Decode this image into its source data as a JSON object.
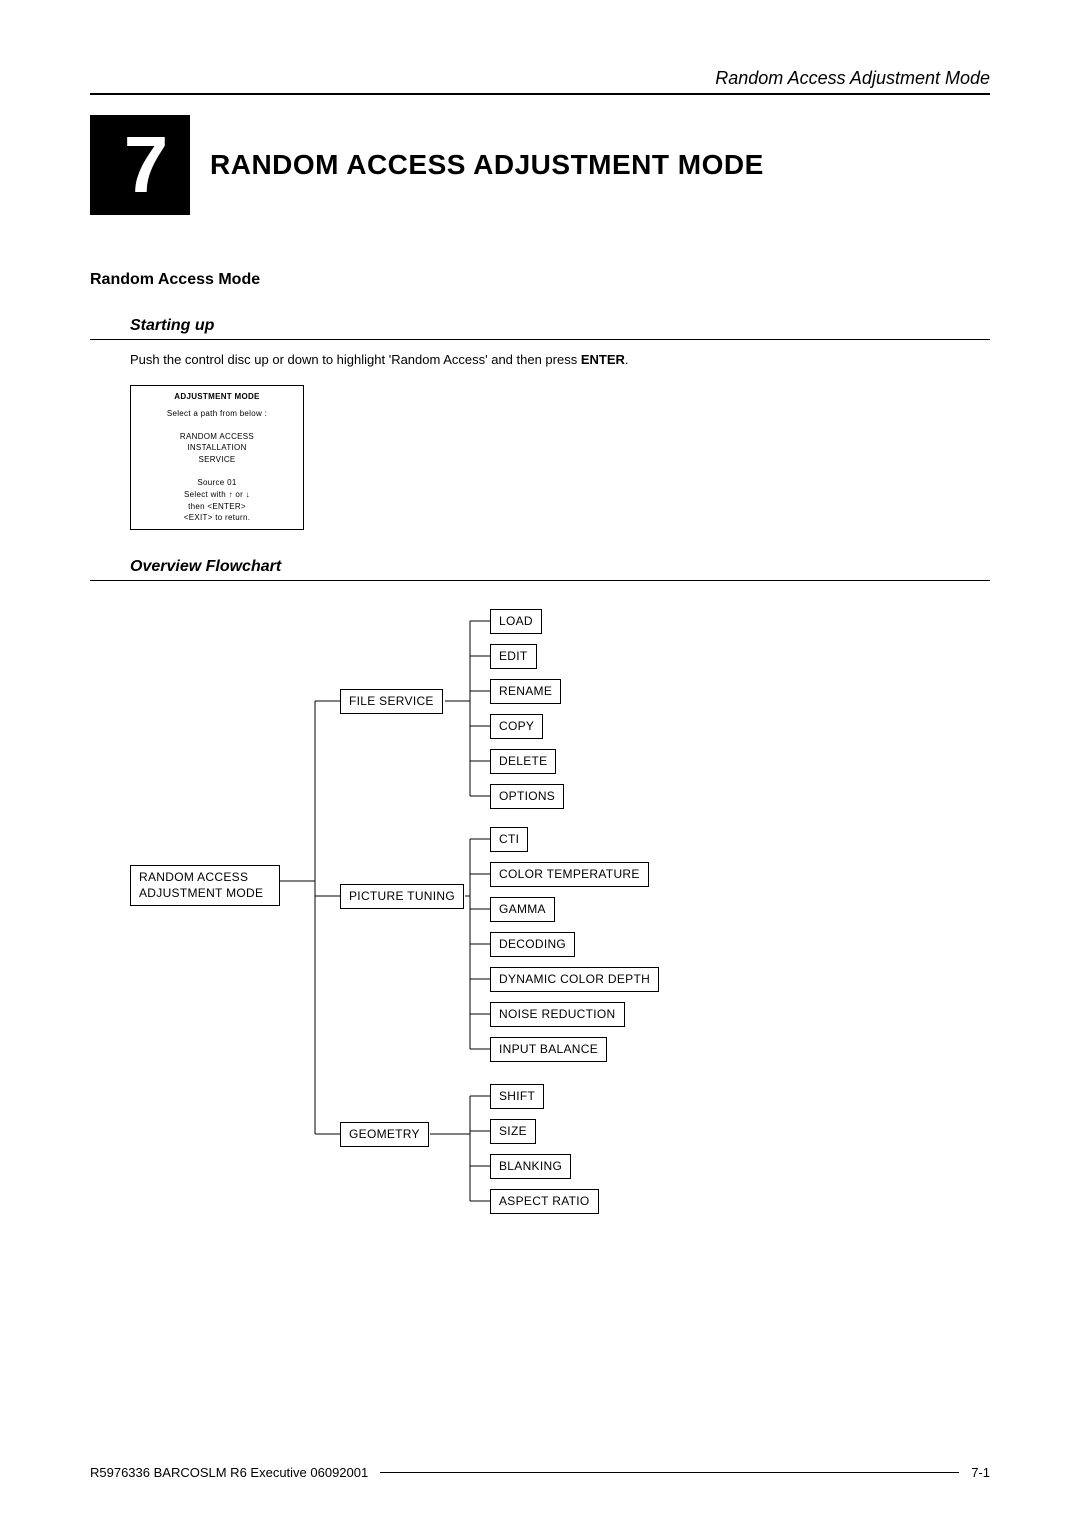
{
  "page": {
    "running_title": "Random Access Adjustment Mode",
    "chapter_number": "7",
    "chapter_title": "RANDOM ACCESS ADJUSTMENT MODE",
    "section_heading": "Random Access Mode",
    "sub_starting_up": "Starting up",
    "sub_overview": "Overview Flowchart",
    "body_push_pre": "Push the control disc up or down to highlight 'Random Access' and then press ",
    "body_push_bold": "ENTER",
    "body_push_post": ".",
    "footer_left": "R5976336 BARCOSLM R6 Executive 06092001",
    "footer_right": "7-1"
  },
  "menu_box": {
    "title": "ADJUSTMENT MODE",
    "prompt": "Select a path from below :",
    "items": [
      "RANDOM ACCESS",
      "INSTALLATION",
      "SERVICE"
    ],
    "source": "Source 01",
    "select_with_pre": "Select with ",
    "select_with_mid": " or ",
    "then_enter": "then <ENTER>",
    "exit_return": "<EXIT> to return."
  },
  "flowchart": {
    "root": "RANDOM ACCESS\nADJUSTMENT MODE",
    "branches": [
      {
        "label": "FILE SERVICE",
        "children": [
          "LOAD",
          "EDIT",
          "RENAME",
          "COPY",
          "DELETE",
          "OPTIONS"
        ]
      },
      {
        "label": "PICTURE TUNING",
        "children": [
          "CTI",
          "COLOR TEMPERATURE",
          "GAMMA",
          "DECODING",
          "DYNAMIC COLOR DEPTH",
          "NOISE REDUCTION",
          "INPUT BALANCE"
        ]
      },
      {
        "label": "GEOMETRY",
        "children": [
          "SHIFT",
          "SIZE",
          "BLANKING",
          "ASPECT RATIO"
        ]
      }
    ]
  }
}
